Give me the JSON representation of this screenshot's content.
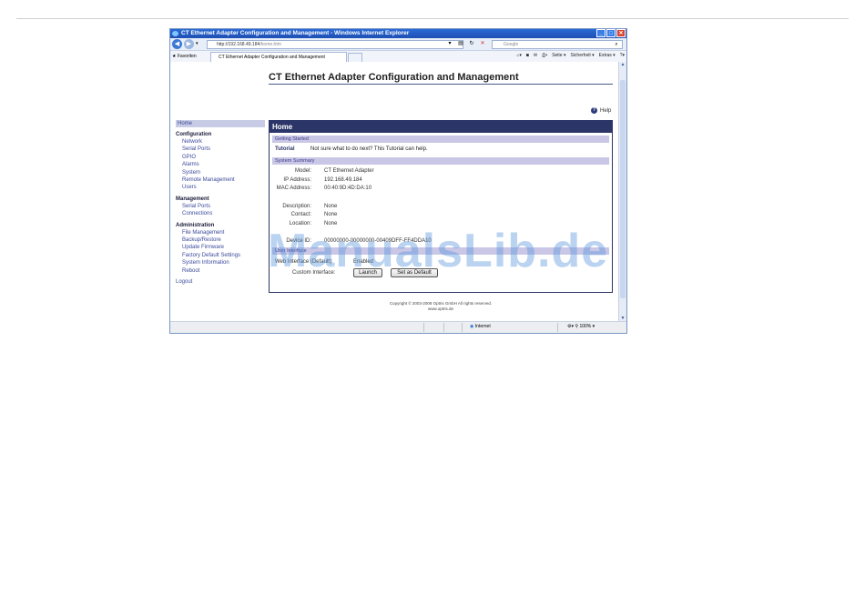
{
  "browser": {
    "title": "CT Ethernet Adapter Configuration and Management - Windows Internet Explorer",
    "address_prefix": "http://192.168.49.184",
    "address_path": "/home.htm",
    "search_placeholder": "Google",
    "favorites_label": "Favoriten",
    "tab_label": "CT Ethernet Adapter Configuration and Management",
    "cmd_page": "Seite ▾",
    "cmd_security": "Sicherheit ▾",
    "cmd_extras": "Extras ▾",
    "status_zone": "Internet",
    "status_zoom": "100%"
  },
  "page": {
    "title": "CT Ethernet Adapter Configuration and Management",
    "help_label": "Help"
  },
  "sidebar": {
    "home": "Home",
    "configuration": {
      "heading": "Configuration",
      "items": [
        "Network",
        "Serial Ports",
        "GPIO",
        "Alarms",
        "System",
        "Remote Management",
        "Users"
      ]
    },
    "management": {
      "heading": "Management",
      "items": [
        "Serial Ports",
        "Connections"
      ]
    },
    "administration": {
      "heading": "Administration",
      "items": [
        "File Management",
        "Backup/Restore",
        "Update Firmware",
        "Factory Default Settings",
        "System Information",
        "Reboot"
      ]
    },
    "logout": "Logout"
  },
  "main": {
    "header": "Home",
    "getting_started": "Getting Started",
    "tutorial_label": "Tutorial",
    "tutorial_text": "Not sure what to do next? This Tutorial can help.",
    "system_summary": "System Summary",
    "model_label": "Model:",
    "model_value": "CT Ethernet Adapter",
    "ip_label": "IP Address:",
    "ip_value": "192.168.49.184",
    "mac_label": "MAC Address:",
    "mac_value": "00:40:9D:4D:DA:10",
    "desc_label": "Description:",
    "desc_value": "None",
    "contact_label": "Contact:",
    "contact_value": "None",
    "location_label": "Location:",
    "location_value": "None",
    "device_id_label": "Device ID:",
    "device_id_value": "00000000-00000000-00409DFF-FF4DDA10",
    "user_interface": "User Interface",
    "web_interface_label": "Web Interface (Default):",
    "web_interface_value": "Enabled",
    "custom_interface_label": "Custom Interface:",
    "launch_button": "Launch",
    "set_default_button": "Set as Default"
  },
  "footer": {
    "copyright": "Copyright © 2003-2008 Optris GmbH All rights reserved.",
    "url": "www.optris.de"
  },
  "watermark": "ManualsLib.de"
}
